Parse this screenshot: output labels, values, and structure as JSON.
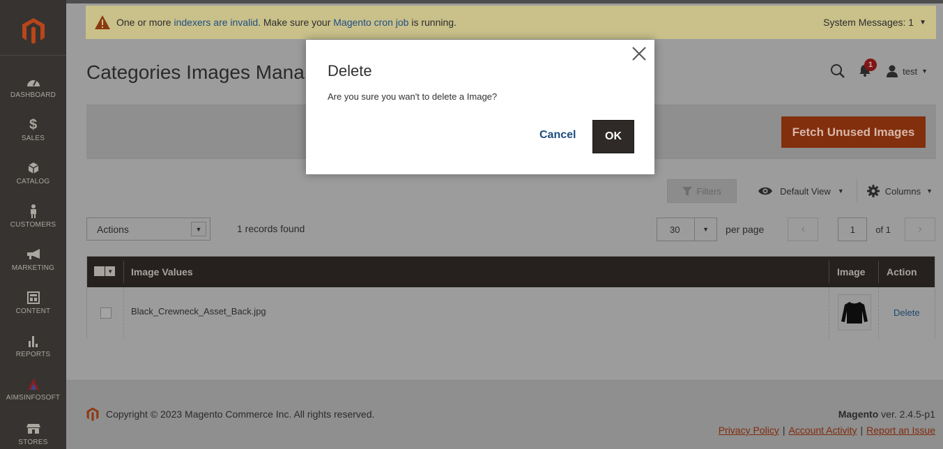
{
  "sidebar": {
    "items": [
      {
        "label": "DASHBOARD",
        "icon": "dashboard-icon"
      },
      {
        "label": "SALES",
        "icon": "dollar-icon"
      },
      {
        "label": "CATALOG",
        "icon": "box-icon"
      },
      {
        "label": "CUSTOMERS",
        "icon": "person-icon"
      },
      {
        "label": "MARKETING",
        "icon": "megaphone-icon"
      },
      {
        "label": "CONTENT",
        "icon": "layout-icon"
      },
      {
        "label": "REPORTS",
        "icon": "bar-chart-icon"
      },
      {
        "label": "AIMSINFOSOFT",
        "icon": "aims-logo-icon"
      },
      {
        "label": "STORES",
        "icon": "store-icon"
      }
    ]
  },
  "system_message": {
    "text_before": "One or more ",
    "link1": "indexers are invalid",
    "text_middle": ". Make sure your ",
    "link2": "Magento cron job",
    "text_after": " is running.",
    "right_label": "System Messages: 1"
  },
  "header": {
    "page_title": "Categories Images Mana",
    "notification_count": "1",
    "user_name": "test"
  },
  "page_actions": {
    "fetch_button": "Fetch Unused Images"
  },
  "grid_tools": {
    "filters_label": "Filters",
    "view_label": "Default View",
    "columns_label": "Columns"
  },
  "toolbar": {
    "actions_label": "Actions",
    "records_found": "1 records found",
    "per_page_value": "30",
    "per_page_label": "per page",
    "page_input": "1",
    "page_of": "of 1"
  },
  "grid": {
    "columns": [
      "Image Values",
      "Image",
      "Action"
    ],
    "rows": [
      {
        "image_value": "Black_Crewneck_Asset_Back.jpg",
        "action": "Delete"
      }
    ]
  },
  "footer": {
    "copyright": "Copyright © 2023 Magento Commerce Inc. All rights reserved.",
    "brand": "Magento",
    "version": " ver. 2.4.5-p1",
    "links": [
      "Privacy Policy",
      "Account Activity",
      "Report an Issue"
    ]
  },
  "modal": {
    "title": "Delete",
    "message": "Are you sure you wan't to delete a Image?",
    "cancel_label": "Cancel",
    "ok_label": "OK"
  },
  "colors": {
    "sidebar_bg": "#373330",
    "accent_orange": "#eb5202",
    "grid_header_bg": "#514943",
    "link_blue": "#007bdb"
  }
}
